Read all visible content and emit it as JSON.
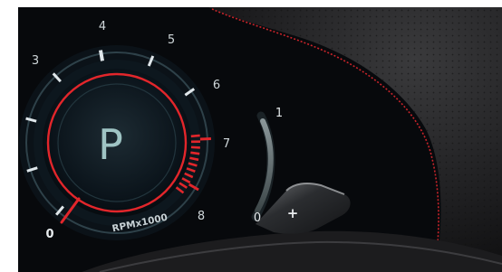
{
  "gauge": {
    "gear": "P",
    "unit": "RPMx1000",
    "ticks": [
      "0",
      "3",
      "4",
      "5",
      "6",
      "7",
      "8"
    ]
  },
  "fuel": {
    "full": "1",
    "empty": "0"
  },
  "paddle": {
    "symbol": "+"
  },
  "colors": {
    "accent_red": "#e2262b",
    "tick_white": "#dfe6ea",
    "gauge_teal": "#8fb3b5",
    "bezel": "#0e1822",
    "leather": "#2b2b2d"
  }
}
